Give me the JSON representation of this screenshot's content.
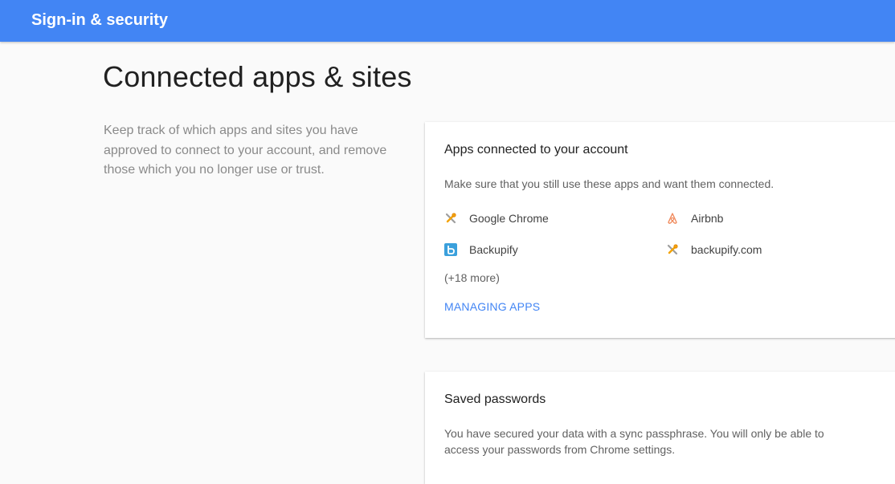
{
  "header": {
    "title": "Sign-in & security",
    "background": "#4285f4"
  },
  "main": {
    "title": "Connected apps & sites",
    "description": "Keep track of which apps and sites you have approved to connect to your account, and remove those which you no longer use or trust."
  },
  "apps_card": {
    "heading": "Apps connected to your account",
    "text": "Make sure that you still use these apps and want them connected.",
    "apps": [
      {
        "label": "Google Chrome",
        "icon": "key-tools-icon"
      },
      {
        "label": "Airbnb",
        "icon": "airbnb-icon"
      },
      {
        "label": "Backupify",
        "icon": "backupify-icon"
      },
      {
        "label": "backupify.com",
        "icon": "key-tools-icon"
      }
    ],
    "more": "(+18 more)",
    "link": "MANAGING APPS",
    "link_color": "#4285f4"
  },
  "passwords_card": {
    "heading": "Saved passwords",
    "text": "You have secured your data with a sync passphrase. You will only be able to access your passwords from Chrome settings."
  }
}
